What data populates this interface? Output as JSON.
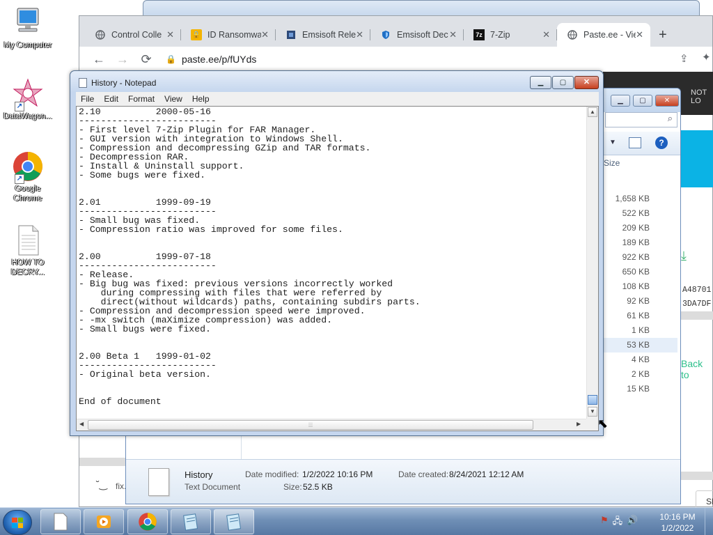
{
  "desktop": {
    "icons": [
      {
        "label": "My Computer"
      },
      {
        "label": "DataWagon..."
      },
      {
        "label": "Google Chrome"
      },
      {
        "label": "HOW TO DECRY..."
      }
    ]
  },
  "chrome": {
    "tabs": [
      {
        "title": "Control Colle",
        "icon": "globe-icon"
      },
      {
        "title": "ID Ransomwa",
        "icon": "lock-icon"
      },
      {
        "title": "Emsisoft Rele",
        "icon": "emsisoft-icon"
      },
      {
        "title": "Emsisoft Dec",
        "icon": "shield-icon"
      },
      {
        "title": "7-Zip",
        "icon": "7zip-icon"
      },
      {
        "title": "Paste.ee - Vie",
        "icon": "globe-icon"
      }
    ],
    "url": "paste.ee/p/fUYds",
    "page_right": {
      "nav_text": "NOT LO",
      "hash_lines": [
        "A48701",
        "3DA7DF"
      ],
      "back_link": "Back to",
      "button_text": "Sh"
    },
    "bottom": {
      "fix_label": "fix."
    }
  },
  "explorer": {
    "size_header": "Size",
    "sizes": [
      "1,658 KB",
      "522 KB",
      "209 KB",
      "189 KB",
      "922 KB",
      "650 KB",
      "108 KB",
      "92 KB",
      "61 KB",
      "1 KB",
      "53 KB",
      "4 KB",
      "2 KB",
      "15 KB"
    ],
    "selected_index": 10,
    "details": {
      "name": "History",
      "type": "Text Document",
      "date_modified_label": "Date modified:",
      "date_modified": "1/2/2022 10:16 PM",
      "date_created_label": "Date created:",
      "date_created": "8/24/2021 12:12 AM",
      "size_label": "Size:",
      "size": "52.5 KB"
    }
  },
  "notepad": {
    "title": "History - Notepad",
    "menu": [
      "File",
      "Edit",
      "Format",
      "View",
      "Help"
    ],
    "content": "2.10          2000-05-16\n-------------------------\n- First level 7-Zip Plugin for FAR Manager.\n- GUI version with integration to Windows Shell.\n- Compression and decompressing GZip and TAR formats.\n- Decompression RAR.\n- Install & Uninstall support.\n- Some bugs were fixed.\n\n\n2.01          1999-09-19\n-------------------------\n- Small bug was fixed.\n- Compression ratio was improved for some files.\n\n\n2.00          1999-07-18\n-------------------------\n- Release.\n- Big bug was fixed: previous versions incorrectly worked\n    during compressing with files that were referred by\n    direct(without wildcards) paths, containing subdirs parts.\n- Compression and decompression speed were improved.\n- -mx switch (maXimize compression) was added.\n- Small bugs were fixed.\n\n\n2.00 Beta 1   1999-01-02\n-------------------------\n- Original beta version.\n\n\nEnd of document"
  },
  "taskbar": {
    "time": "10:16 PM",
    "date": "1/2/2022"
  }
}
